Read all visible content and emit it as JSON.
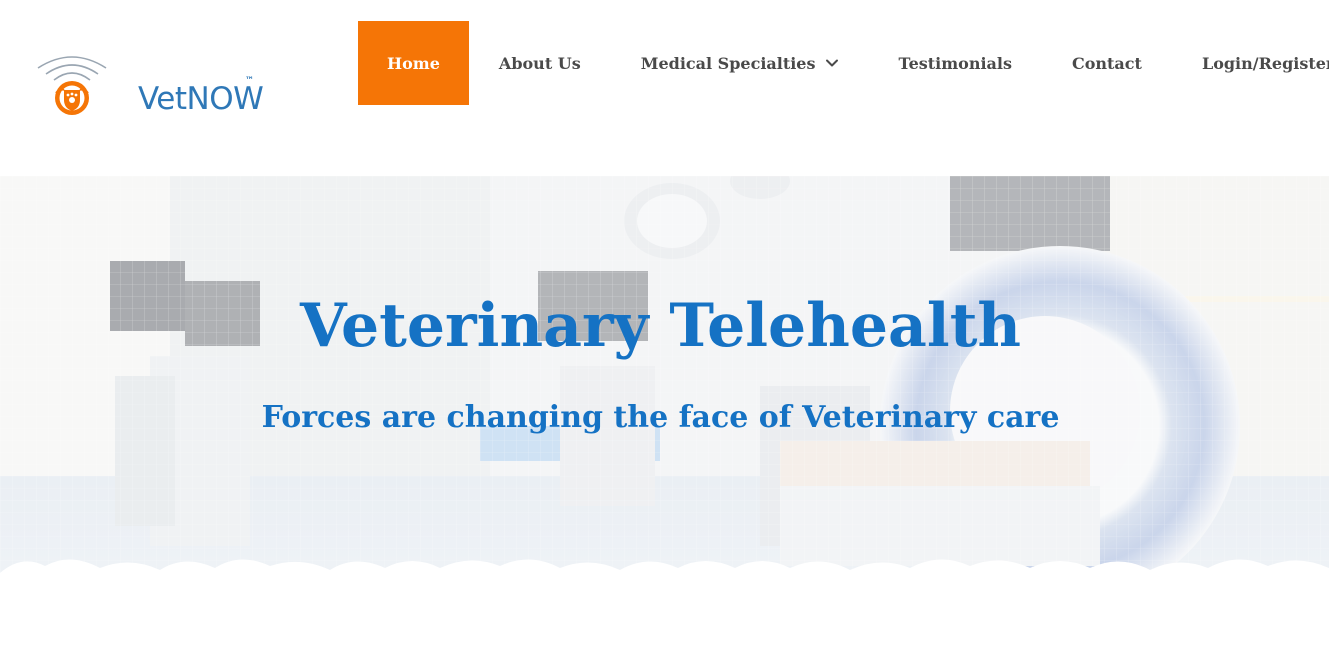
{
  "brand": {
    "name": "VetNOW",
    "trademark": "™",
    "primary_color": "#2f78b7",
    "accent_color": "#f57506",
    "logo_icon": "paw-shield-icon"
  },
  "nav": {
    "items": [
      {
        "label": "Home",
        "active": true
      },
      {
        "label": "About Us",
        "active": false
      },
      {
        "label": "Medical Specialties",
        "active": false,
        "icon": "chevron-down-icon"
      },
      {
        "label": "Testimonials",
        "active": false
      },
      {
        "label": "Contact",
        "active": false
      },
      {
        "label": "Login/Register",
        "active": false
      }
    ]
  },
  "hero": {
    "title": "Veterinary Telehealth",
    "subtitle": "Forces are changing the face of Veterinary care",
    "text_color": "#1572c4",
    "background": "faded-operating-room-image"
  }
}
